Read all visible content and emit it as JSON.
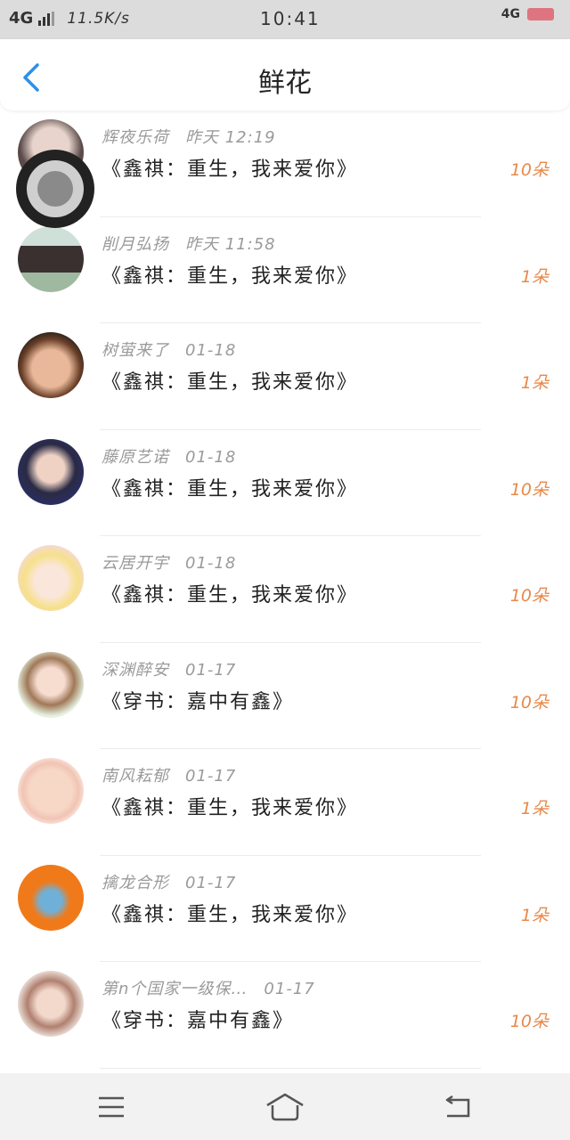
{
  "status_bar": {
    "network_left": "4G",
    "speed": "11.5K/s",
    "time": "10:41",
    "network_right": "4G"
  },
  "header": {
    "title": "鲜花",
    "back_icon": "chevron-left-icon"
  },
  "colors": {
    "accent": "#2f8fe6",
    "amount": "#e8894a",
    "meta": "#9a9a9a",
    "status_bg": "#dcdcdc"
  },
  "items": [
    {
      "name": "辉夜乐荷",
      "time": "昨天 12:19",
      "title": "《鑫祺：重生，我来爱你》",
      "amount": "10朵"
    },
    {
      "name": "削月弘扬",
      "time": "昨天 11:58",
      "title": "《鑫祺：重生，我来爱你》",
      "amount": "1朵"
    },
    {
      "name": "树萤来了",
      "time": "01-18",
      "title": "《鑫祺：重生，我来爱你》",
      "amount": "1朵"
    },
    {
      "name": "藤原艺诺",
      "time": "01-18",
      "title": "《鑫祺：重生，我来爱你》",
      "amount": "10朵"
    },
    {
      "name": "云居开宇",
      "time": "01-18",
      "title": "《鑫祺：重生，我来爱你》",
      "amount": "10朵"
    },
    {
      "name": "深渊醉安",
      "time": "01-17",
      "title": "《穿书：嘉中有鑫》",
      "amount": "10朵"
    },
    {
      "name": "南风耘郁",
      "time": "01-17",
      "title": "《鑫祺：重生，我来爱你》",
      "amount": "1朵"
    },
    {
      "name": "擒龙合形",
      "time": "01-17",
      "title": "《鑫祺：重生，我来爱你》",
      "amount": "1朵"
    },
    {
      "name": "第n个国家一级保…",
      "time": "01-17",
      "title": "《穿书：嘉中有鑫》",
      "amount": "10朵"
    }
  ],
  "bottom_nav": {
    "menu_icon": "menu-icon",
    "home_icon": "home-icon",
    "back_icon": "return-icon"
  }
}
